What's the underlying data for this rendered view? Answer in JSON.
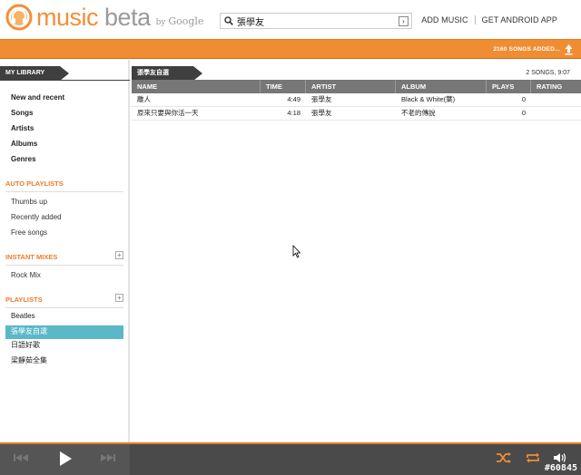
{
  "app": {
    "logo_primary": "music",
    "logo_secondary": "beta",
    "logo_by": "by",
    "logo_brand": "Google",
    "accent": "#f08d33",
    "selection_color": "#5ab8c7"
  },
  "search": {
    "value": "張學友",
    "icon": "search-icon",
    "go_icon": "chevron-right-icon"
  },
  "header_links": [
    "ADD MUSIC",
    "GET ANDROID APP"
  ],
  "status": {
    "text": "2160 SONGS ADDED...",
    "icon": "upload-icon"
  },
  "sidebar": {
    "tab": "MY LIBRARY",
    "library": [
      "New and recent",
      "Songs",
      "Artists",
      "Albums",
      "Genres"
    ],
    "auto_playlists": {
      "title": "AUTO PLAYLISTS",
      "items": [
        "Thumbs up",
        "Recently added",
        "Free songs"
      ]
    },
    "instant_mixes": {
      "title": "INSTANT MIXES",
      "add": "+",
      "items": [
        "Rock Mix"
      ]
    },
    "playlists": {
      "title": "PLAYLISTS",
      "add": "+",
      "items": [
        "Beatles",
        "張學友自選",
        "日語好歌",
        "梁靜茹全集"
      ],
      "selected_index": 1
    }
  },
  "main": {
    "tab": "張學友自選",
    "meta": "2 SONGS, 9:07",
    "columns": [
      "NAME",
      "TIME",
      "ARTIST",
      "ALBUM",
      "PLAYS",
      "RATING"
    ],
    "rows": [
      [
        "離人",
        "4:49",
        "張學友",
        "Black & White(葉)",
        "0",
        ""
      ],
      [
        "原來只要與你活一天",
        "4:18",
        "張學友",
        "不老的傳說",
        "0",
        ""
      ]
    ]
  },
  "player": {
    "controls": [
      "previous-icon",
      "play-icon",
      "next-icon"
    ],
    "right_controls": [
      "shuffle-icon",
      "repeat-icon",
      "volume-icon"
    ]
  },
  "watermark": "#60845"
}
